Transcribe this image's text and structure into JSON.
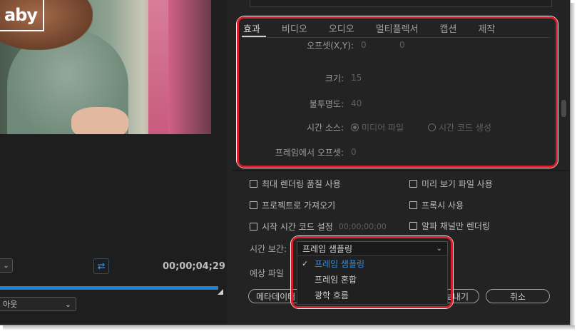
{
  "preview": {
    "logo_text": "aby",
    "timecode": "00;00;04;29",
    "playback_mode": "아웃"
  },
  "tabs": [
    {
      "label": "효과",
      "active": true
    },
    {
      "label": "비디오",
      "active": false
    },
    {
      "label": "오디오",
      "active": false
    },
    {
      "label": "멀티플렉서",
      "active": false
    },
    {
      "label": "캡션",
      "active": false
    },
    {
      "label": "제작",
      "active": false
    }
  ],
  "effects": {
    "offset_label": "오프셋(X,Y):",
    "offset_x": "0",
    "offset_y": "0",
    "size_label": "크기:",
    "size_value": "15",
    "opacity_label": "불투명도:",
    "opacity_value": "40",
    "time_source_label": "시간 소스:",
    "time_source_option1": "미디어 파일",
    "time_source_option2": "시간 코드 생성",
    "frame_offset_label": "프레임에서 오프셋:",
    "frame_offset_value": "0"
  },
  "settings": {
    "max_render_quality": "최대 렌더링 품질 사용",
    "use_previews": "미리 보기 파일 사용",
    "import_into_project": "프로젝트로 가져오기",
    "use_proxies": "프록시 사용",
    "set_start_timecode": "시작 시간 코드 설정",
    "start_timecode_value": "00;00;00;00",
    "render_alpha_only": "알파 채널만 렌더링",
    "time_interpolation_label": "시간 보간:",
    "time_interpolation_value": "프레임 샘플링",
    "estimated_file_label": "예상 파일",
    "interpolation_options": [
      "프레임 샘플링",
      "프레임 혼합",
      "광학 흐름"
    ]
  },
  "buttons": {
    "metadata": "메타데이터",
    "export": "내보내기",
    "cancel": "취소"
  },
  "colors": {
    "accent": "#2f8fe8",
    "highlight": "#d61f2c",
    "panel": "#232323"
  }
}
